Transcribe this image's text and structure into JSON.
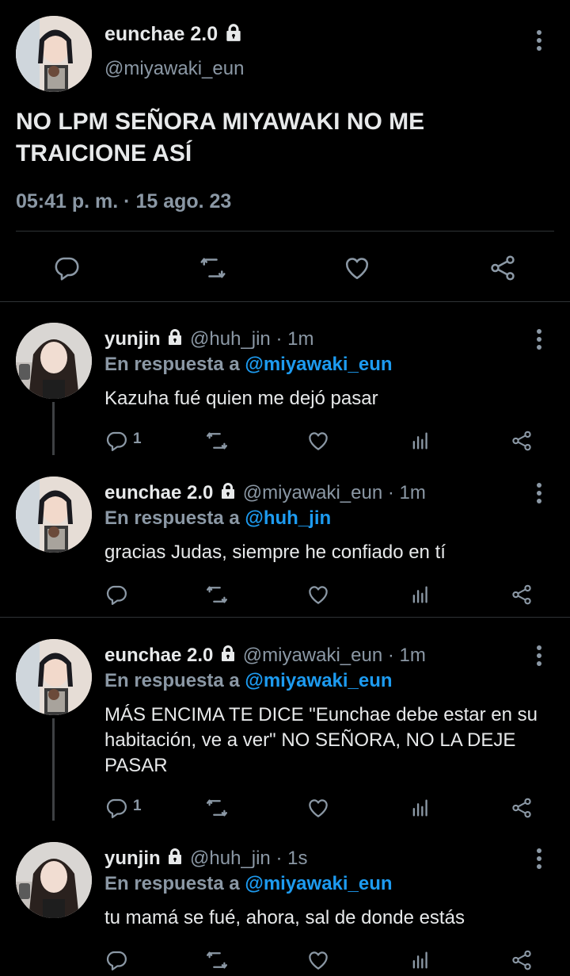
{
  "main_tweet": {
    "name": "eunchae 2.0",
    "handle": "@miyawaki_eun",
    "text": "NO LPM SEÑORA MIYAWAKI NO ME TRAICIONE ASÍ",
    "timestamp": "05:41 p. m. · 15 ago. 23"
  },
  "replies": [
    {
      "name": "yunjin",
      "handle": "@huh_jin",
      "time": " · 1m",
      "reply_prefix": "En respuesta a ",
      "reply_to": "@miyawaki_eun",
      "text": "Kazuha fué quien me dejó pasar",
      "reply_count": "1"
    },
    {
      "name": "eunchae 2.0",
      "handle": "@miyawaki_eun",
      "time": " · 1m",
      "reply_prefix": "En respuesta a ",
      "reply_to": "@huh_jin",
      "text": "gracias Judas, siempre he confiado en tí",
      "reply_count": ""
    },
    {
      "name": "eunchae 2.0",
      "handle": "@miyawaki_eun",
      "time": " · 1m",
      "reply_prefix": "En respuesta a ",
      "reply_to": "@miyawaki_eun",
      "text": "MÁS ENCIMA TE DICE \"Eunchae debe estar en su habitación, ve a ver\" NO SEÑORA, NO LA DEJE PASAR",
      "reply_count": "1"
    },
    {
      "name": "yunjin",
      "handle": "@huh_jin",
      "time": " · 1s",
      "reply_prefix": "En respuesta a ",
      "reply_to": "@miyawaki_eun",
      "text": "tu mamá se fué, ahora, sal de donde estás",
      "reply_count": ""
    }
  ],
  "colors": {
    "background": "#000000",
    "text": "#e7e9ea",
    "secondary": "#8b98a5",
    "link": "#1d9bf0",
    "divider": "#2f3336"
  },
  "icons": [
    "lock-icon",
    "more-icon",
    "reply-icon",
    "retweet-icon",
    "like-icon",
    "analytics-icon",
    "share-icon"
  ]
}
